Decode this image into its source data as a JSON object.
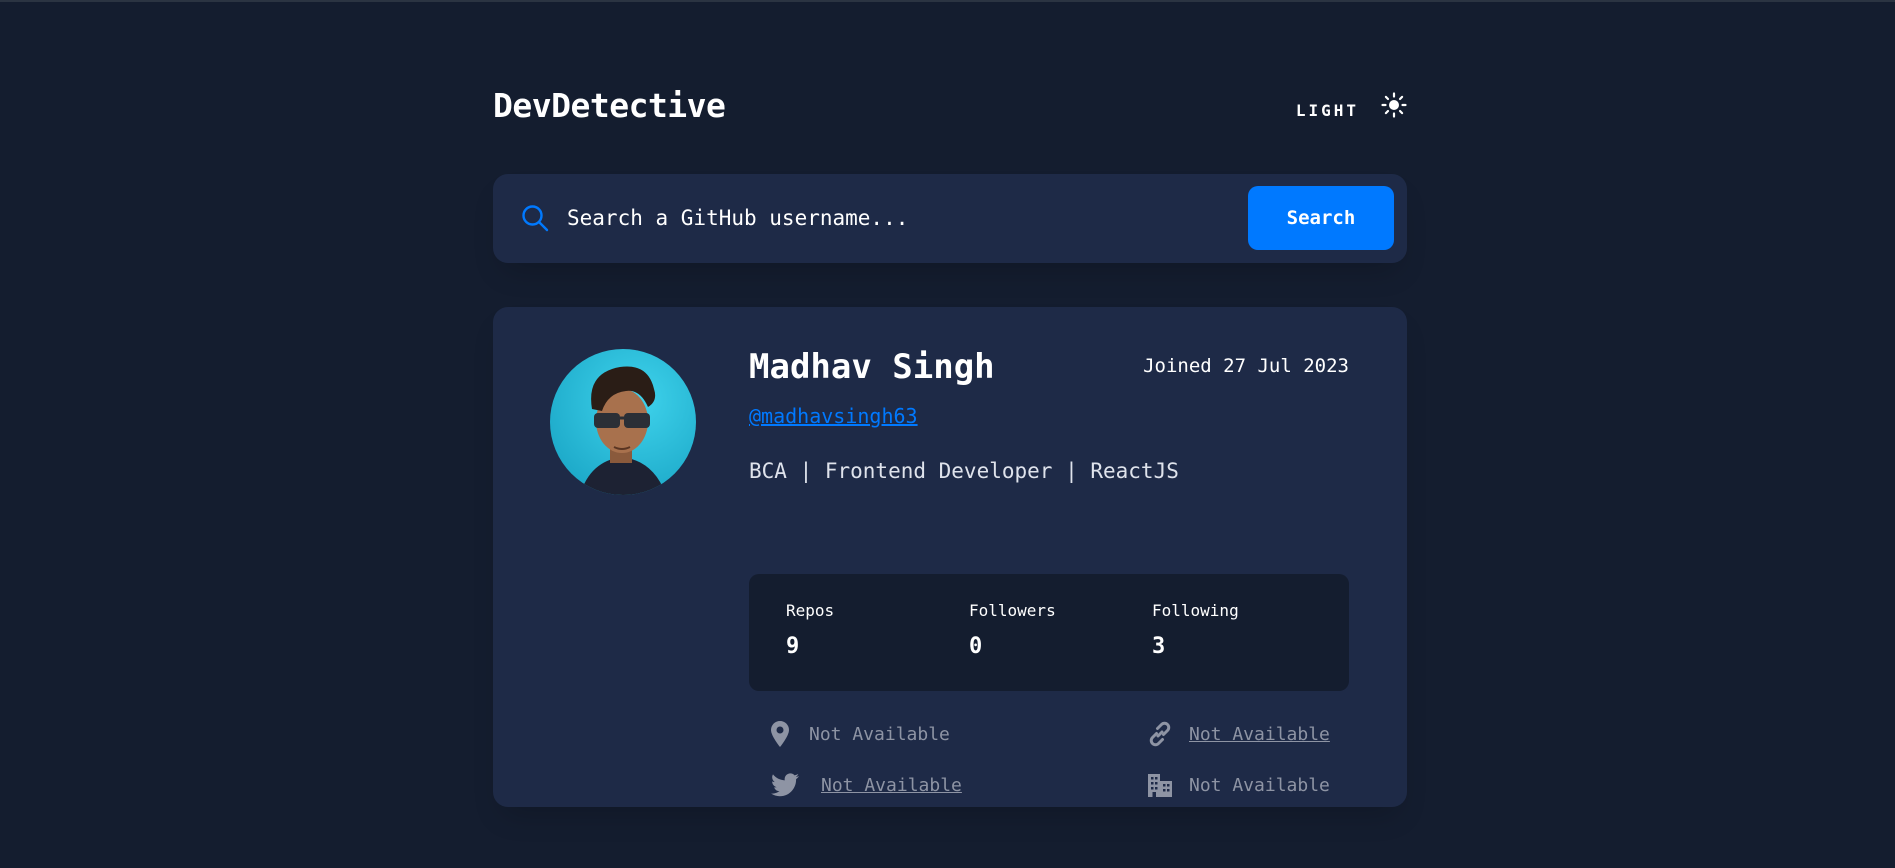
{
  "app": {
    "title": "DevDetective"
  },
  "theme_toggle": {
    "label": "LIGHT",
    "icon": "sun-icon"
  },
  "search": {
    "placeholder": "Search a GitHub username...",
    "button_label": "Search",
    "icon": "search-icon"
  },
  "profile": {
    "name": "Madhav Singh",
    "joined": "Joined 27 Jul 2023",
    "handle": "@madhavsingh63",
    "bio": "BCA | Frontend Developer | ReactJS",
    "stats": [
      {
        "label": "Repos",
        "value": "9"
      },
      {
        "label": "Followers",
        "value": "0"
      },
      {
        "label": "Following",
        "value": "3"
      }
    ],
    "links": {
      "location": "Not Available",
      "website": "Not Available",
      "twitter": "Not Available",
      "company": "Not Available"
    }
  },
  "colors": {
    "background": "#141d2f",
    "card": "#1e2a47",
    "accent": "#0079ff",
    "muted_text": "#8e94a4"
  }
}
